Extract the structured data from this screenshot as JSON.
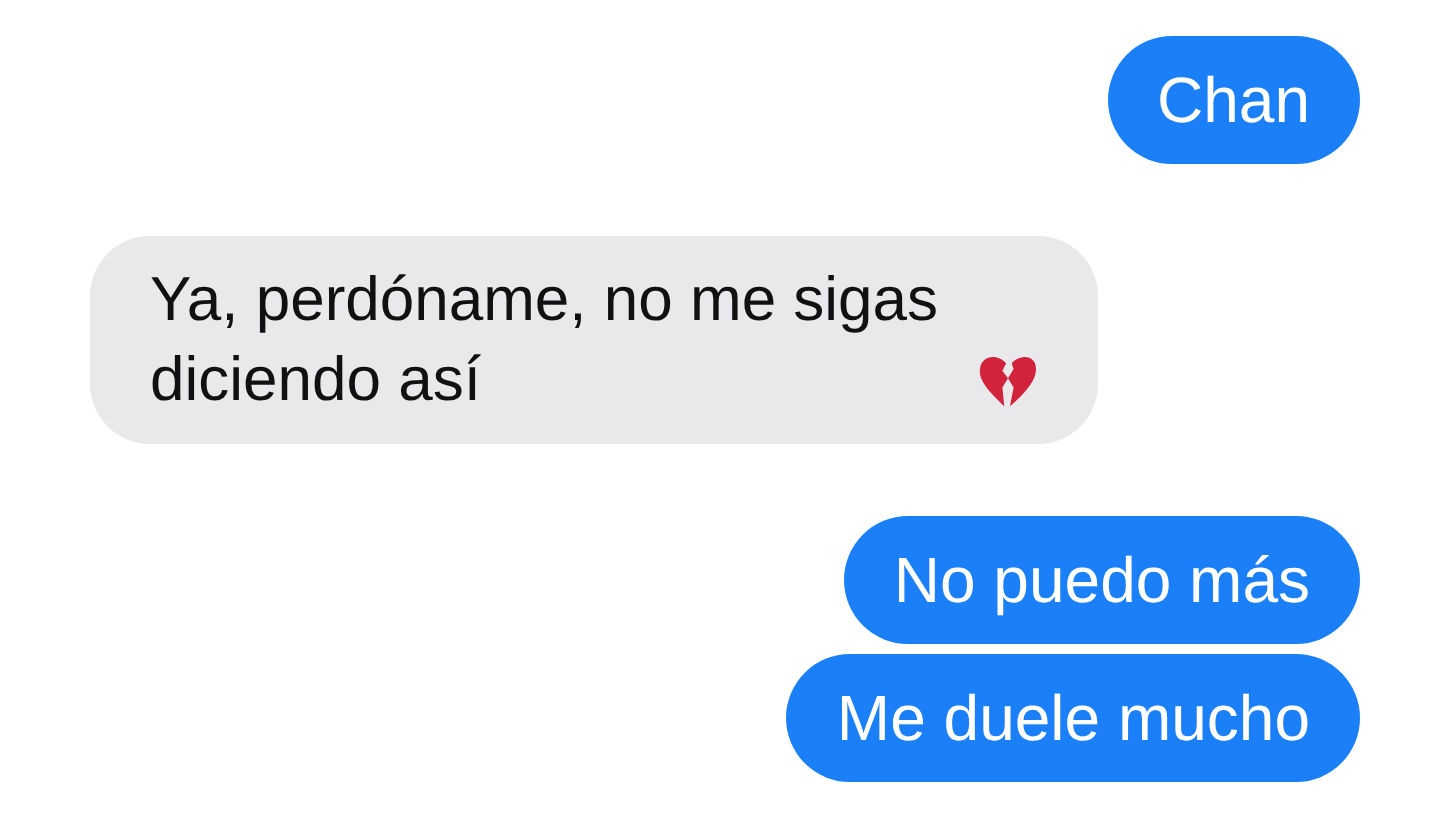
{
  "messages": [
    {
      "kind": "sent",
      "text": "Chan"
    },
    {
      "kind": "received",
      "text": "Ya, perdóname, no me sigas diciendo así"
    },
    {
      "kind": "sent",
      "text": "No puedo más"
    },
    {
      "kind": "sent",
      "text": "Me duele mucho"
    }
  ]
}
